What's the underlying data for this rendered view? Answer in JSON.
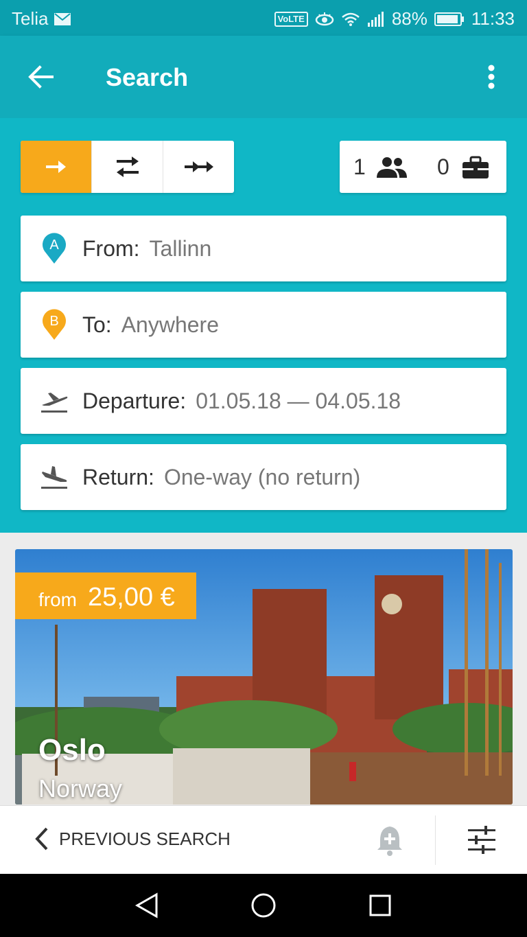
{
  "status_bar": {
    "carrier": "Telia",
    "volte": "VoLTE",
    "battery": "88%",
    "time": "11:33",
    "icons": [
      "mail-icon",
      "eye-icon",
      "wifi-icon",
      "signal-icon",
      "battery-icon"
    ]
  },
  "app_bar": {
    "title": "Search",
    "back_icon": "arrow-back-icon",
    "menu_icon": "more-vert-icon"
  },
  "trip_type": {
    "options": [
      {
        "icon": "one-way-arrow-icon",
        "selected": true
      },
      {
        "icon": "return-arrows-icon",
        "selected": false
      },
      {
        "icon": "multi-city-arrows-icon",
        "selected": false
      }
    ]
  },
  "passengers": {
    "count": "1",
    "bags": "0"
  },
  "fields": {
    "from": {
      "label": "From:",
      "value": "Tallinn"
    },
    "to": {
      "label": "To:",
      "value": "Anywhere"
    },
    "departure": {
      "label": "Departure:",
      "value": "01.05.18 — 04.05.18"
    },
    "return": {
      "label": "Return:",
      "value": "One-way (no return)"
    }
  },
  "destination_card": {
    "price_from": "from",
    "price": "25,00 €",
    "city": "Oslo",
    "country": "Norway"
  },
  "bottom_bar": {
    "previous_search": "PREVIOUS SEARCH"
  },
  "colors": {
    "accent": "#f7a91b",
    "primary": "#12acbb",
    "panel": "#10b7c6",
    "status": "#0b9fae"
  }
}
